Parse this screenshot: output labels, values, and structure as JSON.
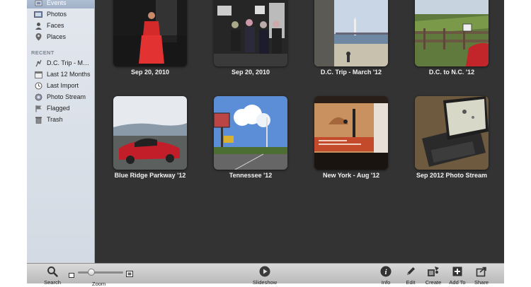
{
  "sidebar": {
    "library_items": [
      {
        "label": "Events",
        "icon": "events-icon",
        "selected": true
      },
      {
        "label": "Photos",
        "icon": "photos-icon"
      },
      {
        "label": "Faces",
        "icon": "faces-icon"
      },
      {
        "label": "Places",
        "icon": "places-icon"
      }
    ],
    "recent_heading": "RECENT",
    "recent_items": [
      {
        "label": "D.C. Trip - M…",
        "icon": "event-pin-icon"
      },
      {
        "label": "Last 12 Months",
        "icon": "calendar-icon"
      },
      {
        "label": "Last Import",
        "icon": "clock-icon"
      },
      {
        "label": "Photo Stream",
        "icon": "photo-stream-icon"
      },
      {
        "label": "Flagged",
        "icon": "flag-icon"
      },
      {
        "label": "Trash",
        "icon": "trash-icon"
      }
    ]
  },
  "events": [
    {
      "title": "Sep 20, 2010"
    },
    {
      "title": "Sep 20, 2010"
    },
    {
      "title": "D.C. Trip - March '12"
    },
    {
      "title": "D.C. to N.C. '12"
    },
    {
      "title": "Blue Ridge Parkway '12"
    },
    {
      "title": "Tennessee '12"
    },
    {
      "title": "New York - Aug '12"
    },
    {
      "title": "Sep 2012 Photo Stream"
    }
  ],
  "toolbar": {
    "search_label": "Search",
    "zoom_label": "Zoom",
    "zoom_level": 0.25,
    "slideshow_label": "Slideshow",
    "info_label": "Info",
    "edit_label": "Edit",
    "create_label": "Create",
    "add_to_label": "Add To",
    "share_label": "Share"
  },
  "colors": {
    "sidebar_selected": "#a9b8cd",
    "grid_background": "#333333",
    "caption_text": "#f2f2f2"
  }
}
